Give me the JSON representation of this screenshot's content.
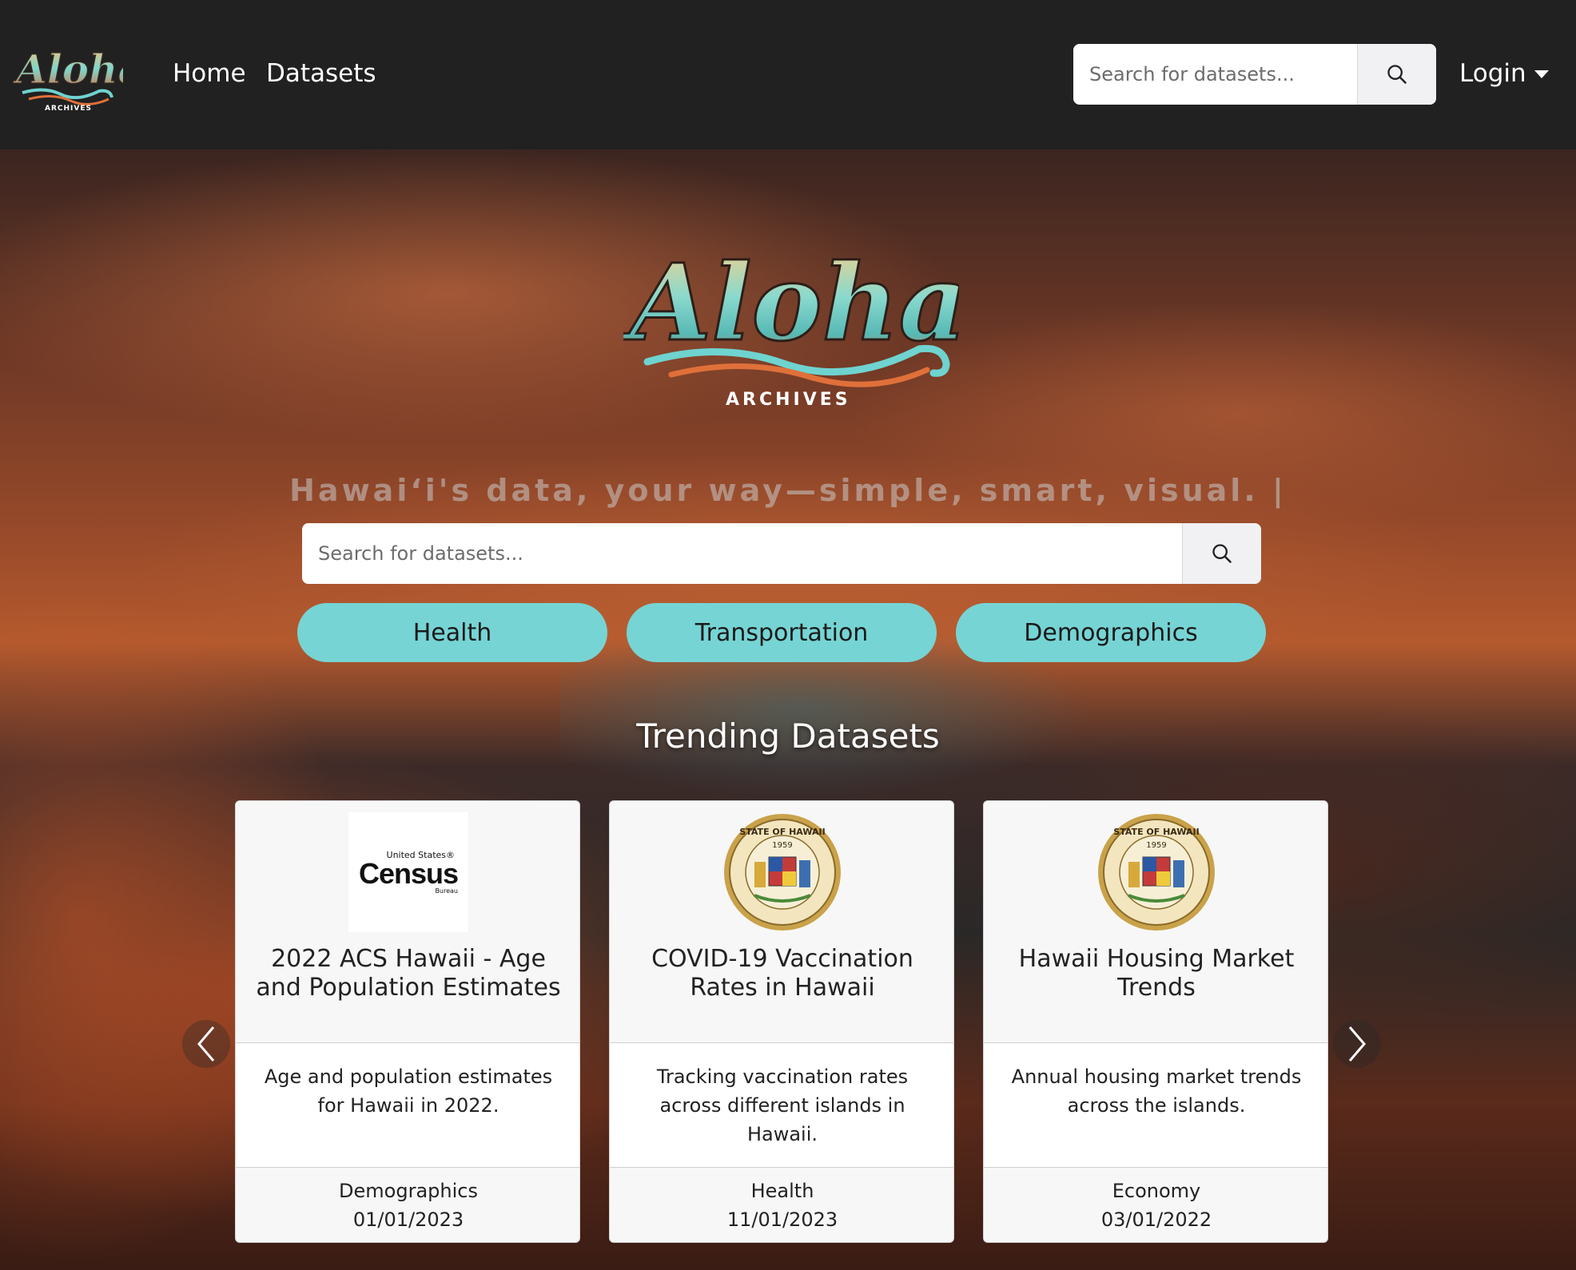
{
  "brand": {
    "name": "Aloha",
    "sub": "ARCHIVES"
  },
  "nav": {
    "home": "Home",
    "datasets": "Datasets",
    "login": "Login"
  },
  "search": {
    "placeholder": "Search for datasets..."
  },
  "hero": {
    "tagline": "Hawaiʻi's data, your way—simple, smart, visual. |",
    "categories": [
      "Health",
      "Transportation",
      "Demographics"
    ],
    "section_title": "Trending Datasets"
  },
  "cards": [
    {
      "logo": "census-logo",
      "logo_text_top": "United States®",
      "logo_text_main": "Census",
      "logo_text_bottom": "Bureau",
      "title": "2022 ACS Hawaii - Age and Population Estimates",
      "description": "Age and population estimates for Hawaii in 2022.",
      "category": "Demographics",
      "date": "01/01/2023"
    },
    {
      "logo": "state-seal",
      "seal_text": "STATE OF HAWAII",
      "seal_year": "1959",
      "title": "COVID-19 Vaccination Rates in Hawaii",
      "description": "Tracking vaccination rates across different islands in Hawaii.",
      "category": "Health",
      "date": "11/01/2023"
    },
    {
      "logo": "state-seal",
      "seal_text": "STATE OF HAWAII",
      "seal_year": "1959",
      "title": "Hawaii Housing Market Trends",
      "description": "Annual housing market trends across the islands.",
      "category": "Economy",
      "date": "03/01/2022"
    }
  ],
  "colors": {
    "navbar": "#212121",
    "pill": "#76d4d4",
    "logo_teal": "#6fd3cf",
    "logo_orange": "#e0703a"
  }
}
